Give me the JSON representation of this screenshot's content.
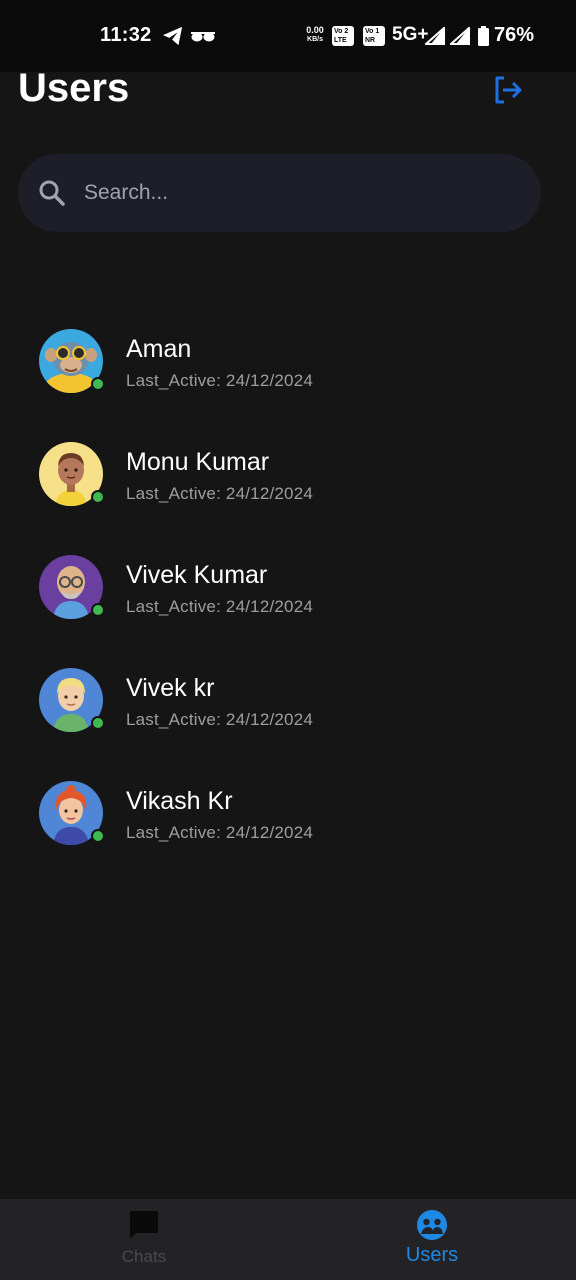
{
  "status_bar": {
    "time": "11:32",
    "speed_value": "0.00",
    "speed_unit": "KB/s",
    "volte_1": "Vo 2\nLTE",
    "volte_2": "Vo 1\nNR",
    "network": "5G+",
    "battery": "76%"
  },
  "header": {
    "title": "Users",
    "logout_icon": "logout-icon"
  },
  "search": {
    "placeholder": "Search...",
    "icon": "search-icon"
  },
  "users": [
    {
      "name": "Aman",
      "last_active": "Last_Active: 24/12/2024",
      "online": true,
      "avatar_bg": "#3ba8e0"
    },
    {
      "name": "Monu Kumar",
      "last_active": "Last_Active: 24/12/2024",
      "online": true,
      "avatar_bg": "#f7e08a"
    },
    {
      "name": "Vivek Kumar",
      "last_active": "Last_Active: 24/12/2024",
      "online": true,
      "avatar_bg": "#6b3fa0"
    },
    {
      "name": "Vivek kr",
      "last_active": "Last_Active: 24/12/2024",
      "online": true,
      "avatar_bg": "#4f86d6"
    },
    {
      "name": "Vikash Kr",
      "last_active": "Last_Active: 24/12/2024",
      "online": true,
      "avatar_bg": "#4f86d6"
    }
  ],
  "bottom_nav": {
    "items": [
      {
        "label": "Chats",
        "icon": "chat-bubble-icon",
        "active": false
      },
      {
        "label": "Users",
        "icon": "users-icon",
        "active": true
      }
    ]
  },
  "colors": {
    "background": "#151515",
    "accent": "#1e88e5",
    "online": "#3fb950",
    "search_bg": "#1e1e28"
  }
}
